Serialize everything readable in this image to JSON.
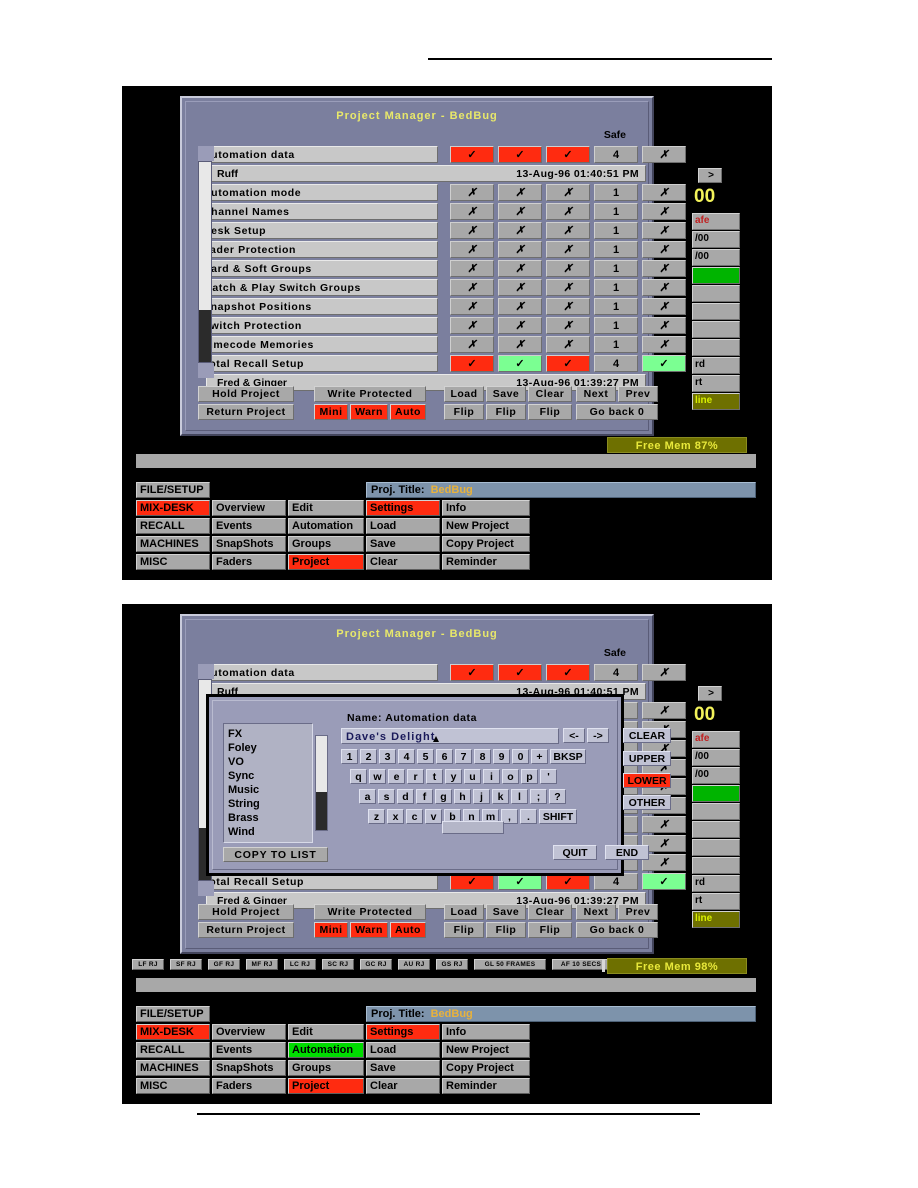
{
  "page": {
    "rule_top": true,
    "rule_bottom": true
  },
  "window": {
    "title": "Project  Manager  -  BedBug",
    "safe_header": "Safe"
  },
  "table": {
    "rows": [
      {
        "name": "Automation data",
        "c1": "✓",
        "c2": "✓",
        "c3": "✓",
        "num": "4",
        "safe": "✗",
        "s1": "red",
        "s2": "red",
        "s3": "red",
        "ssafe": "grey"
      },
      {
        "name": "Automation mode",
        "c1": "✗",
        "c2": "✗",
        "c3": "✗",
        "num": "1",
        "safe": "✗",
        "s1": "grey",
        "s2": "grey",
        "s3": "grey",
        "ssafe": "grey"
      },
      {
        "name": "Channel Names",
        "c1": "✗",
        "c2": "✗",
        "c3": "✗",
        "num": "1",
        "safe": "✗",
        "s1": "grey",
        "s2": "grey",
        "s3": "grey",
        "ssafe": "grey"
      },
      {
        "name": "Desk Setup",
        "c1": "✗",
        "c2": "✗",
        "c3": "✗",
        "num": "1",
        "safe": "✗",
        "s1": "grey",
        "s2": "grey",
        "s3": "grey",
        "ssafe": "grey"
      },
      {
        "name": "Fader Protection",
        "c1": "✗",
        "c2": "✗",
        "c3": "✗",
        "num": "1",
        "safe": "✗",
        "s1": "grey",
        "s2": "grey",
        "s3": "grey",
        "ssafe": "grey"
      },
      {
        "name": "Hard  &  Soft  Groups",
        "c1": "✗",
        "c2": "✗",
        "c3": "✗",
        "num": "1",
        "safe": "✗",
        "s1": "grey",
        "s2": "grey",
        "s3": "grey",
        "ssafe": "grey"
      },
      {
        "name": "Match  &  Play  Switch  Groups",
        "c1": "✗",
        "c2": "✗",
        "c3": "✗",
        "num": "1",
        "safe": "✗",
        "s1": "grey",
        "s2": "grey",
        "s3": "grey",
        "ssafe": "grey"
      },
      {
        "name": "Snapshot Positions",
        "c1": "✗",
        "c2": "✗",
        "c3": "✗",
        "num": "1",
        "safe": "✗",
        "s1": "grey",
        "s2": "grey",
        "s3": "grey",
        "ssafe": "grey"
      },
      {
        "name": "Switch Protection",
        "c1": "✗",
        "c2": "✗",
        "c3": "✗",
        "num": "1",
        "safe": "✗",
        "s1": "grey",
        "s2": "grey",
        "s3": "grey",
        "ssafe": "grey"
      },
      {
        "name": "Timecode Memories",
        "c1": "✗",
        "c2": "✗",
        "c3": "✗",
        "num": "1",
        "safe": "✗",
        "s1": "grey",
        "s2": "grey",
        "s3": "grey",
        "ssafe": "grey"
      },
      {
        "name": "Total Recall Setup",
        "c1": "✓",
        "c2": "✓",
        "c3": "✓",
        "num": "4",
        "safe": "✓",
        "s1": "red",
        "s2": "green",
        "s3": "red",
        "ssafe": "green"
      }
    ],
    "detail_row_1": {
      "name": "Ruff",
      "date": "13-Aug-96  01:40:51  PM"
    },
    "detail_row_2": {
      "name": "Fred  &  Ginger",
      "date": "13-Aug-96  01:39:27  PM"
    }
  },
  "buttons": {
    "hold_project": "Hold  Project",
    "return_project": "Return  Project",
    "write_protected": "Write  Protected",
    "mini": "Mini",
    "warn": "Warn",
    "auto": "Auto",
    "load": "Load",
    "save": "Save",
    "clear": "Clear",
    "next": "Next",
    "prev": "Prev",
    "load_flip": "Flip",
    "save_flip": "Flip",
    "clear_flip": "Flip",
    "go_back": "Go  back  0"
  },
  "right_strip": {
    "arrow": ">",
    "big_number": "00",
    "boxes": [
      {
        "label": "afe",
        "style": "red-txt"
      },
      {
        "label": "/00",
        "style": "plain"
      },
      {
        "label": "/00",
        "style": "plain"
      },
      {
        "label": "",
        "style": "green"
      },
      {
        "label": "",
        "style": "plain"
      },
      {
        "label": "",
        "style": "plain"
      },
      {
        "label": "",
        "style": "plain"
      },
      {
        "label": "",
        "style": "plain"
      },
      {
        "label": "rd",
        "style": "plain"
      },
      {
        "label": "rt",
        "style": "plain"
      },
      {
        "label": "line",
        "style": "olive"
      }
    ]
  },
  "free_mem": {
    "shot1": "Free  Mem  87%",
    "shot2": "Free  Mem  98%"
  },
  "menu": {
    "proj_title_label": "Proj.  Title:",
    "proj_title_value": "BedBug",
    "col1": [
      "FILE/SETUP",
      "MIX-DESK",
      "RECALL",
      "MACHINES",
      "MISC"
    ],
    "col2": [
      "Overview",
      "Events",
      "SnapShots",
      "Faders"
    ],
    "col3": [
      "Edit",
      "Automation",
      "Groups",
      "Project"
    ],
    "col4": [
      "Settings",
      "Load",
      "Save",
      "Clear"
    ],
    "col5": [
      "Info",
      "New  Project",
      "Copy  Project",
      "Reminder"
    ],
    "highlight_shot1": {
      "mix_desk": "red",
      "settings": "red",
      "project": "red",
      "automation": "plain"
    },
    "highlight_shot2": {
      "mix_desk": "red",
      "settings": "red",
      "project": "red",
      "automation": "green"
    }
  },
  "dialog": {
    "name_label": "Name:  Automation  data",
    "field_value": "Dave's Delight",
    "nav_left": "<-",
    "nav_right": "->",
    "clear": "CLEAR",
    "row_digits": [
      "1",
      "2",
      "3",
      "4",
      "5",
      "6",
      "7",
      "8",
      "9",
      "0",
      "+"
    ],
    "bksp": "BKSP",
    "row_q": [
      "q",
      "w",
      "e",
      "r",
      "t",
      "y",
      "u",
      "i",
      "o",
      "p",
      "'"
    ],
    "row_a": [
      "a",
      "s",
      "d",
      "f",
      "g",
      "h",
      "j",
      "k",
      "l",
      ";",
      "?"
    ],
    "row_z": [
      "z",
      "x",
      "c",
      "v",
      "b",
      "n",
      "m",
      ",",
      "."
    ],
    "shift": "SHIFT",
    "upper": "UPPER",
    "lower": "LOWER",
    "other": "OTHER",
    "quit": "QUIT",
    "end": "END",
    "copy_to_list": "COPY  TO  LIST",
    "list_items": [
      "FX",
      "Foley",
      "VO",
      "Sync",
      "Music",
      "String",
      "Brass",
      "Wind"
    ]
  },
  "chips": [
    "LF RJ",
    "SF RJ",
    "GF RJ",
    "MF RJ",
    "LC RJ",
    "SC RJ",
    "GC RJ",
    "AU RJ",
    "GS RJ",
    "GL 50 FRAMES",
    "AF 10 SECS"
  ],
  "colors": {
    "red": "#ff2b10",
    "green": "#7bff92",
    "menu_green": "#00dd00",
    "panel": "#7b7f9e",
    "title_yellow": "#e8e86a",
    "olive": "#6e7000"
  }
}
